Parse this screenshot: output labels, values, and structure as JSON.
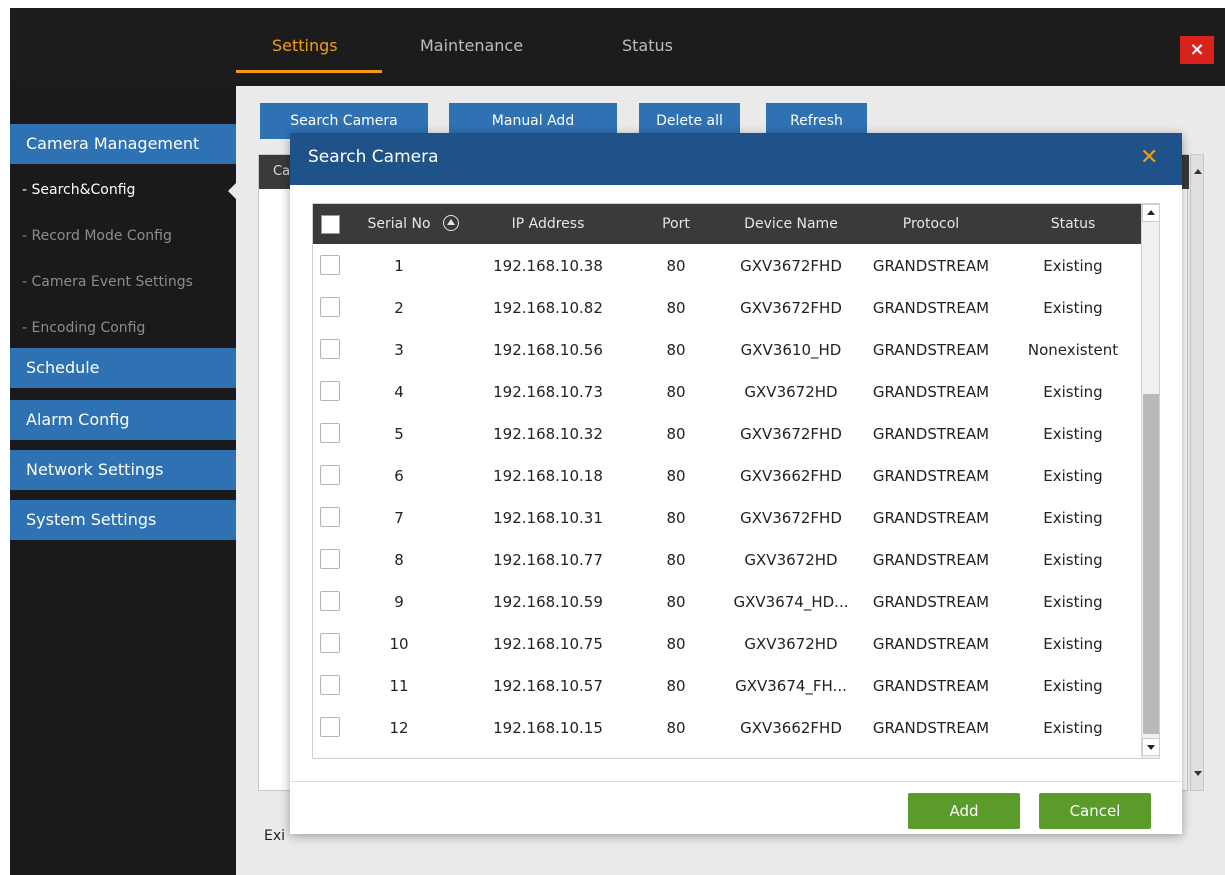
{
  "top_tabs": [
    {
      "label": "Settings",
      "active": true
    },
    {
      "label": "Maintenance",
      "active": false
    },
    {
      "label": "Status",
      "active": false
    }
  ],
  "close_label": "×",
  "sidebar": {
    "items": [
      {
        "label": "Camera Management",
        "type": "main"
      },
      {
        "label": "- Search&Config",
        "type": "sub",
        "active": true
      },
      {
        "label": "- Record Mode Config",
        "type": "sub"
      },
      {
        "label": "- Camera Event Settings",
        "type": "sub"
      },
      {
        "label": "- Encoding Config",
        "type": "sub"
      },
      {
        "label": "Schedule",
        "type": "main"
      },
      {
        "label": "Alarm Config",
        "type": "main"
      },
      {
        "label": "Network Settings",
        "type": "main"
      },
      {
        "label": "System Settings",
        "type": "main"
      }
    ]
  },
  "toolbar": {
    "search_camera": "Search Camera",
    "manual_add": "Manual Add",
    "delete_all": "Delete all",
    "refresh": "Refresh"
  },
  "background": {
    "header_partial": "Ca",
    "exit_partial": "Exi"
  },
  "dialog": {
    "title": "Search Camera",
    "close_label": "✕",
    "columns": [
      "Serial No",
      "IP Address",
      "Port",
      "Device Name",
      "Protocol",
      "Status"
    ],
    "rows": [
      {
        "serial": "1",
        "ip": "192.168.10.38",
        "port": "80",
        "device": "GXV3672FHD",
        "protocol": "GRANDSTREAM",
        "status": "Existing"
      },
      {
        "serial": "2",
        "ip": "192.168.10.82",
        "port": "80",
        "device": "GXV3672FHD",
        "protocol": "GRANDSTREAM",
        "status": "Existing"
      },
      {
        "serial": "3",
        "ip": "192.168.10.56",
        "port": "80",
        "device": "GXV3610_HD",
        "protocol": "GRANDSTREAM",
        "status": "Nonexistent"
      },
      {
        "serial": "4",
        "ip": "192.168.10.73",
        "port": "80",
        "device": "GXV3672HD",
        "protocol": "GRANDSTREAM",
        "status": "Existing"
      },
      {
        "serial": "5",
        "ip": "192.168.10.32",
        "port": "80",
        "device": "GXV3672FHD",
        "protocol": "GRANDSTREAM",
        "status": "Existing"
      },
      {
        "serial": "6",
        "ip": "192.168.10.18",
        "port": "80",
        "device": "GXV3662FHD",
        "protocol": "GRANDSTREAM",
        "status": "Existing"
      },
      {
        "serial": "7",
        "ip": "192.168.10.31",
        "port": "80",
        "device": "GXV3672FHD",
        "protocol": "GRANDSTREAM",
        "status": "Existing"
      },
      {
        "serial": "8",
        "ip": "192.168.10.77",
        "port": "80",
        "device": "GXV3672HD",
        "protocol": "GRANDSTREAM",
        "status": "Existing"
      },
      {
        "serial": "9",
        "ip": "192.168.10.59",
        "port": "80",
        "device": "GXV3674_HD...",
        "protocol": "GRANDSTREAM",
        "status": "Existing"
      },
      {
        "serial": "10",
        "ip": "192.168.10.75",
        "port": "80",
        "device": "GXV3672HD",
        "protocol": "GRANDSTREAM",
        "status": "Existing"
      },
      {
        "serial": "11",
        "ip": "192.168.10.57",
        "port": "80",
        "device": "GXV3674_FH...",
        "protocol": "GRANDSTREAM",
        "status": "Existing"
      },
      {
        "serial": "12",
        "ip": "192.168.10.15",
        "port": "80",
        "device": "GXV3662FHD",
        "protocol": "GRANDSTREAM",
        "status": "Existing"
      }
    ],
    "add_label": "Add",
    "cancel_label": "Cancel"
  },
  "colors": {
    "accent_orange": "#f39c12",
    "sidebar_blue": "#2f72b4",
    "dialog_header": "#1f5288",
    "button_green": "#5a9b2a",
    "close_red": "#d9221c"
  }
}
